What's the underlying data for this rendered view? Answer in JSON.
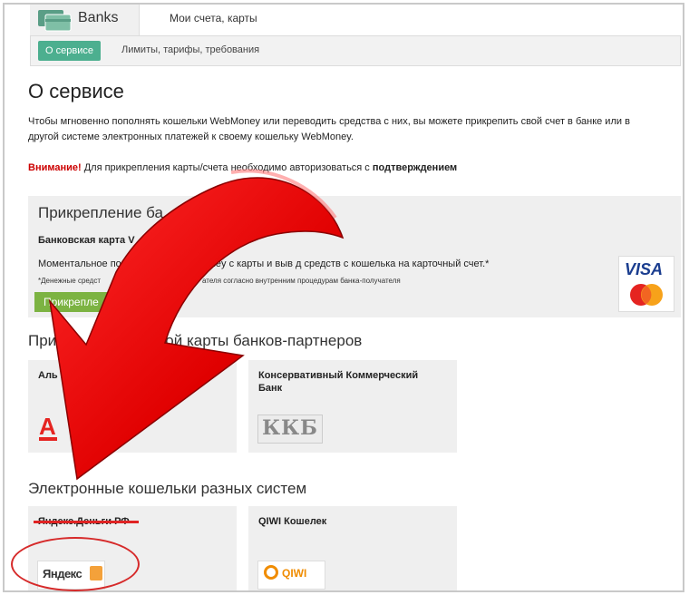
{
  "header": {
    "brand_label": "Banks",
    "tab_accounts": "Мои счета, карты"
  },
  "subnav": {
    "about_button": "О сервисе",
    "limits_link": "Лимиты, тарифы, требования"
  },
  "page": {
    "title": "О сервисе",
    "intro": "Чтобы мгновенно пополнять кошельки WebMoney или переводить средства с них, вы можете прикрепить свой счет в банке или в другой системе электронных платежей к своему кошельку WebMoney.",
    "warning_label": "Внимание!",
    "warning_text": " Для прикрепления карты/счета необходимо авторизоваться с ",
    "warning_bold": "подтверждением"
  },
  "card_section": {
    "title": "Прикрепление ба",
    "subtitle": "Банковская карта V",
    "subtitle_tail": "го",
    "desc": "Моментальное по",
    "desc_tail": "ney с карты и выв  д средств с кошелька на карточный счет.*",
    "note": "*Денежные средст",
    "note_tail": "ателя согласно внутренним процедурам банка-получателя",
    "attach_button": "Прикрепле",
    "visa_text": "VISA",
    "mastercard_text": "MasterCard"
  },
  "partners": {
    "title": "При",
    "title_tail": "ской карты банков-партнеров",
    "items": [
      {
        "name": "Аль",
        "logo_text": "А"
      },
      {
        "name": "Консервативный Коммерческий Банк",
        "logo_text": "ККБ"
      }
    ]
  },
  "wallets": {
    "title": "Электронные кошельки разных систем",
    "items": [
      {
        "name": "Яндекс.Деньги РФ",
        "logo_text": "Яндекс"
      },
      {
        "name": "QIWI Кошелек",
        "logo_text": "QIWI"
      }
    ]
  },
  "colors": {
    "accent_green": "#4caf8f",
    "button_green": "#7cb342",
    "arrow_red": "#e00000",
    "warning_red": "#cc0000"
  }
}
